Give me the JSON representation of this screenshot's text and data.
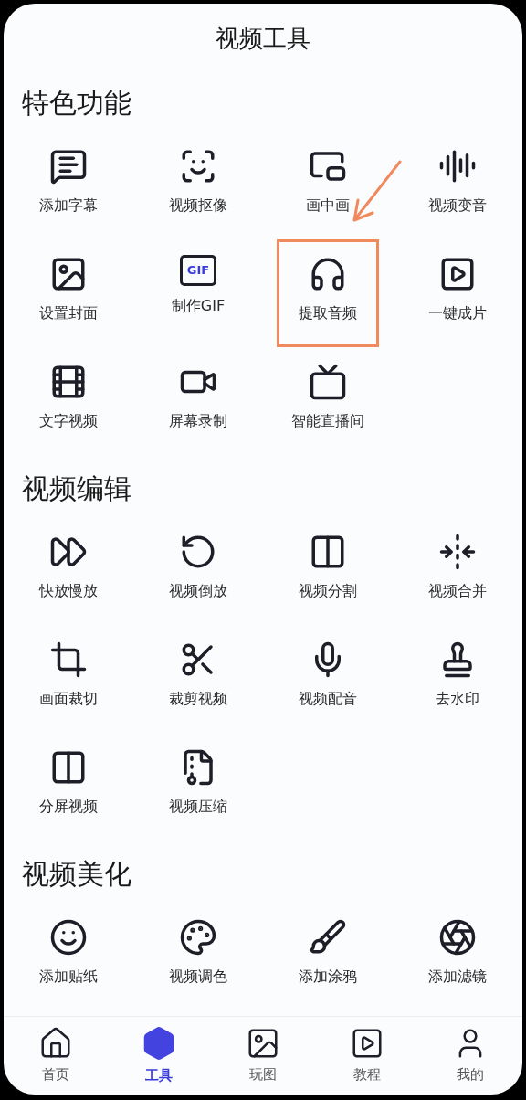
{
  "title": "视频工具",
  "sections": [
    {
      "heading": "特色功能",
      "items": [
        {
          "label": "添加字幕",
          "highlighted": false
        },
        {
          "label": "视频抠像",
          "highlighted": false
        },
        {
          "label": "画中画",
          "highlighted": false
        },
        {
          "label": "视频变音",
          "highlighted": false
        },
        {
          "label": "设置封面",
          "highlighted": false
        },
        {
          "label": "制作GIF",
          "highlighted": false,
          "icon_text": "GIF"
        },
        {
          "label": "提取音频",
          "highlighted": true
        },
        {
          "label": "一键成片",
          "highlighted": false
        },
        {
          "label": "文字视频",
          "highlighted": false
        },
        {
          "label": "屏幕录制",
          "highlighted": false
        },
        {
          "label": "智能直播间",
          "highlighted": false
        }
      ]
    },
    {
      "heading": "视频编辑",
      "items": [
        {
          "label": "快放慢放",
          "highlighted": false
        },
        {
          "label": "视频倒放",
          "highlighted": false
        },
        {
          "label": "视频分割",
          "highlighted": false
        },
        {
          "label": "视频合并",
          "highlighted": false
        },
        {
          "label": "画面裁切",
          "highlighted": false
        },
        {
          "label": "裁剪视频",
          "highlighted": false
        },
        {
          "label": "视频配音",
          "highlighted": false
        },
        {
          "label": "去水印",
          "highlighted": false
        },
        {
          "label": "分屏视频",
          "highlighted": false
        },
        {
          "label": "视频压缩",
          "highlighted": false
        }
      ]
    },
    {
      "heading": "视频美化",
      "items": [
        {
          "label": "添加贴纸",
          "highlighted": false
        },
        {
          "label": "视频调色",
          "highlighted": false
        },
        {
          "label": "添加涂鸦",
          "highlighted": false
        },
        {
          "label": "添加滤镜",
          "highlighted": false
        }
      ]
    }
  ],
  "tabs": [
    {
      "label": "首页",
      "selected": false
    },
    {
      "label": "工具",
      "selected": true
    },
    {
      "label": "玩图",
      "selected": false
    },
    {
      "label": "教程",
      "selected": false
    },
    {
      "label": "我的",
      "selected": false
    }
  ]
}
